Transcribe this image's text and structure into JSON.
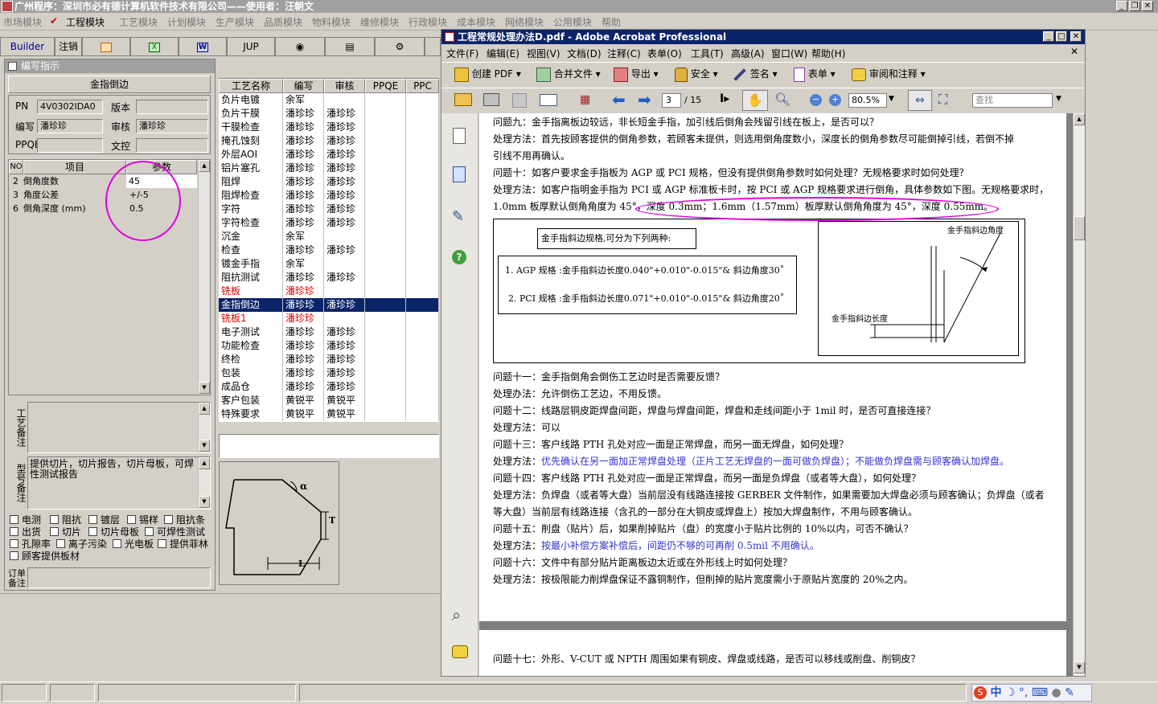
{
  "main_window": {
    "title": "广州程序：深圳市必有德计算机软件技术有限公司——使用者：汪朝文",
    "menu": [
      "市场模块",
      "工程模块",
      "工艺模块",
      "计划模块",
      "生产模块",
      "品质模块",
      "物料模块",
      "维修模块",
      "行政模块",
      "成本模块",
      "网络模块",
      "公用模块",
      "帮助"
    ],
    "active_menu": "工程模块",
    "toolbar": {
      "builder": "Builder",
      "logout": "注销",
      "jup": "JUP"
    }
  },
  "form": {
    "panel_title": "编写指示",
    "process_name": "金指倒边",
    "labels": {
      "pn": "PN",
      "version": "版本",
      "writer": "编写",
      "reviewer": "审核",
      "ppqe": "PPQE",
      "reference": "文控"
    },
    "values": {
      "pn": "4V0302IDA0",
      "version": "",
      "writer": "潘珍珍",
      "reviewer": "潘珍珍",
      "ppqe": "",
      "reference": ""
    },
    "params_headers": [
      "NO",
      "项目",
      "参数"
    ],
    "params": [
      {
        "no": "2",
        "item": "倒角度数",
        "value": "45"
      },
      {
        "no": "3",
        "item": "角度公差",
        "value": "+/-5"
      },
      {
        "no": "6",
        "item": "倒角深度 (mm)",
        "value": "0.5"
      }
    ],
    "process_note_label": "工艺备注",
    "model_note_label": "型号备注",
    "model_note_text": "提供切片，切片报告，切片母板，可焊性测试报告",
    "order_note_label": "订单备注",
    "checkboxes": [
      [
        "电测",
        "阻抗",
        "镀层",
        "锡样",
        "阻抗条"
      ],
      [
        "出货",
        "切片",
        "切片母板",
        "可焊性测试"
      ],
      [
        "孔隙率",
        "离子污染",
        "光电板",
        "提供菲林"
      ],
      [
        "顾客提供板材"
      ]
    ]
  },
  "process_table": {
    "headers": [
      "工艺名称",
      "编写",
      "审核",
      "PPQE",
      "PPC"
    ],
    "rows": [
      {
        "name": "负片电镀",
        "writer": "余军",
        "reviewer": "",
        "status": "normal"
      },
      {
        "name": "负片干膜",
        "writer": "潘珍珍",
        "reviewer": "潘珍珍",
        "status": "normal"
      },
      {
        "name": "干膜检查",
        "writer": "潘珍珍",
        "reviewer": "潘珍珍",
        "status": "normal"
      },
      {
        "name": "掩孔蚀刻",
        "writer": "潘珍珍",
        "reviewer": "潘珍珍",
        "status": "normal"
      },
      {
        "name": "外层AOI",
        "writer": "潘珍珍",
        "reviewer": "潘珍珍",
        "status": "normal"
      },
      {
        "name": "铝片塞孔",
        "writer": "潘珍珍",
        "reviewer": "潘珍珍",
        "status": "normal"
      },
      {
        "name": "阻焊",
        "writer": "潘珍珍",
        "reviewer": "潘珍珍",
        "status": "normal"
      },
      {
        "name": "阻焊检查",
        "writer": "潘珍珍",
        "reviewer": "潘珍珍",
        "status": "normal"
      },
      {
        "name": "字符",
        "writer": "潘珍珍",
        "reviewer": "潘珍珍",
        "status": "normal"
      },
      {
        "name": "字符检查",
        "writer": "潘珍珍",
        "reviewer": "潘珍珍",
        "status": "normal"
      },
      {
        "name": "沉金",
        "writer": "余军",
        "reviewer": "",
        "status": "normal"
      },
      {
        "name": "检查",
        "writer": "潘珍珍",
        "reviewer": "潘珍珍",
        "status": "normal"
      },
      {
        "name": "镀金手指",
        "writer": "余军",
        "reviewer": "",
        "status": "normal"
      },
      {
        "name": "阻抗测试",
        "writer": "潘珍珍",
        "reviewer": "潘珍珍",
        "status": "normal"
      },
      {
        "name": "铣板",
        "writer": "潘珍珍",
        "reviewer": "",
        "status": "red"
      },
      {
        "name": "金指倒边",
        "writer": "潘珍珍",
        "reviewer": "潘珍珍",
        "status": "selected"
      },
      {
        "name": "铣板1",
        "writer": "潘珍珍",
        "reviewer": "",
        "status": "red"
      },
      {
        "name": "电子测试",
        "writer": "潘珍珍",
        "reviewer": "潘珍珍",
        "status": "normal"
      },
      {
        "name": "功能检查",
        "writer": "潘珍珍",
        "reviewer": "潘珍珍",
        "status": "normal"
      },
      {
        "name": "终检",
        "writer": "潘珍珍",
        "reviewer": "潘珍珍",
        "status": "normal"
      },
      {
        "name": "包装",
        "writer": "潘珍珍",
        "reviewer": "潘珍珍",
        "status": "normal"
      },
      {
        "name": "成品仓",
        "writer": "潘珍珍",
        "reviewer": "潘珍珍",
        "status": "normal"
      },
      {
        "name": "客户包装",
        "writer": "黄锐平",
        "reviewer": "黄锐平",
        "status": "normal"
      },
      {
        "name": "特殊要求",
        "writer": "黄锐平",
        "reviewer": "黄锐平",
        "status": "normal"
      }
    ],
    "diagram_labels": {
      "alpha": "α",
      "t": "T",
      "l": "L"
    }
  },
  "acrobat": {
    "title": "工程常规处理办法D.pdf - Adobe Acrobat Professional",
    "menu": [
      "文件(F)",
      "编辑(E)",
      "视图(V)",
      "文档(D)",
      "注释(C)",
      "表单(O)",
      "工具(T)",
      "高级(A)",
      "窗口(W)",
      "帮助(H)"
    ],
    "toolbar1": [
      "创建 PDF",
      "合并文件",
      "导出",
      "安全",
      "签名",
      "表单",
      "审阅和注释"
    ],
    "page_current": "3",
    "page_total": "/ 15",
    "zoom": "80.5%",
    "search_placeholder": "查找",
    "page_lines": [
      {
        "text": "问题九：金手指离板边较远，非长短金手指，加引线后倒角会残留引线在板上，是否可以？",
        "style": "normal"
      },
      {
        "text": "处理方法：首先按顾客提供的倒角参数，若顾客未提供，则选用倒角度数小，深度长的倒角参数尽可能倒掉引线，若倒不掉",
        "style": "normal"
      },
      {
        "text": "引线不用再确认。",
        "style": "normal"
      },
      {
        "text": "问题十：如客户要求金手指板为 AGP 或 PCI 规格，但没有提供倒角参数时如何处理？无规格要求时如何处理？",
        "style": "normal"
      },
      {
        "text": "处理方法：如客户指明金手指为 PCI 或 AGP 标准板卡时，按 PCI 或 AGP 规格要求进行倒角，具体参数如下图。无规格要求时，",
        "style": "normal"
      },
      {
        "text": "1.0mm 板厚默认倒角角度为 45°，深度 0.3mm；1.6mm（1.57mm）板厚默认倒角角度为 45°，深度 0.55mm。",
        "style": "normal"
      }
    ],
    "figure": {
      "caption": "金手指斜边规格,可分为下列两种:",
      "agp": "1. AGP 规格 :金手指斜边长度0.040\"+0.010\"-0.015\"& 斜边角度30˚",
      "pci": "2.  PCI 规格 :金手指斜边长度0.071\"+0.010\"-0.015\"& 斜边角度20˚",
      "angle_label": "金手指斜边角度",
      "length_label": "金手指斜边长度"
    },
    "page_lines2": [
      {
        "text": "问题十一：金手指倒角会倒伤工艺边时是否需要反馈？",
        "style": "normal"
      },
      {
        "text": "处理办法：允许倒伤工艺边，不用反馈。",
        "style": "normal"
      },
      {
        "text": "问题十二：线路层铜皮距焊盘间距，焊盘与焊盘间距，焊盘和走线间距小于 1mil 时，是否可直接连接？",
        "style": "normal"
      },
      {
        "text": "处理方法：可以",
        "style": "normal"
      },
      {
        "text": "问题十三：客户线路 PTH 孔处对应一面是正常焊盘，而另一面无焊盘，如何处理？",
        "style": "normal"
      },
      {
        "text": "处理方法：优先确认在另一面加正常焊盘处理（正片工艺无焊盘的一面可做负焊盘）；不能做负焊盘需与顾客确认加焊盘。",
        "style": "mixed"
      },
      {
        "text": "问题十四：客户线路 PTH 孔处对应一面是正常焊盘，而另一面是负焊盘（或者等大盘），如何处理？",
        "style": "normal"
      },
      {
        "text": "处理方法：负焊盘（或者等大盘）当前层没有线路连接按 GERBER 文件制作，如果需要加大焊盘必须与顾客确认；负焊盘（或者",
        "style": "normal"
      },
      {
        "text": "等大盘）当前层有线路连接（含孔的一部分在大铜皮或焊盘上）按加大焊盘制作，不用与顾客确认。",
        "style": "normal"
      },
      {
        "text": "问题十五：削盘（贴片）后，如果削掉贴片（盘）的宽度小于贴片比例的 10%以内，可否不确认？",
        "style": "normal"
      },
      {
        "text": "处理方法：按最小补偿方案补偿后，间距仍不够的可再削 0.5mil 不用确认。",
        "style": "mixed"
      },
      {
        "text": "问题十六：文件中有部分贴片距离板边太近或在外形线上时如何处理？",
        "style": "normal"
      },
      {
        "text": "处理方法：按极限能力削焊盘保证不露铜制作，但削掉的贴片宽度需小于原贴片宽度的 20%之内。",
        "style": "normal"
      }
    ],
    "page2_lines": [
      {
        "text": "问题十七：外形、V-CUT 或 NPTH 周围如果有铜皮、焊盘或线路，是否可以移线或削盘、削铜皮？"
      }
    ]
  },
  "taskbar": {
    "ime": "中"
  },
  "colors": {
    "selection": "#0a246a",
    "highlight_circle": "#e000e0",
    "red_row": "#e00000",
    "blue_text": "#3333cc"
  }
}
